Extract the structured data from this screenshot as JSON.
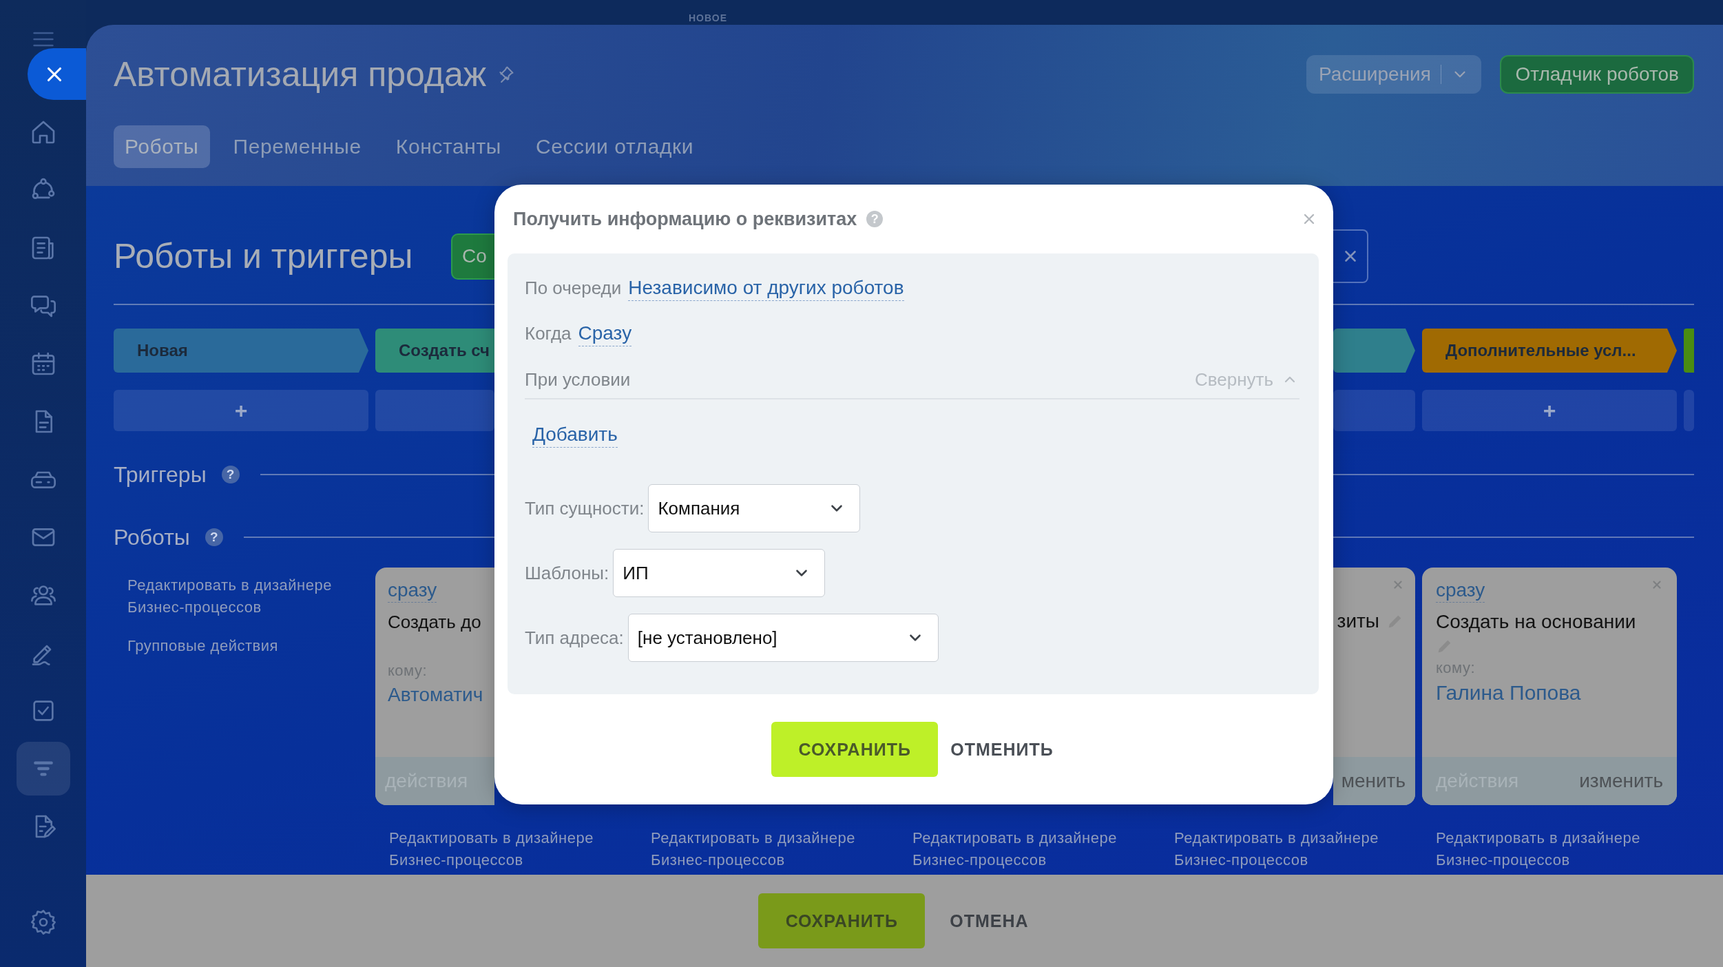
{
  "top_bar": {
    "badge": "НОВОЕ"
  },
  "sidebar": {
    "items": [
      {
        "kind": "menu",
        "selected": false
      },
      {
        "kind": "close",
        "selected": false
      },
      {
        "kind": "home",
        "selected": false
      },
      {
        "kind": "nodes",
        "selected": false
      },
      {
        "kind": "news",
        "selected": false
      },
      {
        "kind": "chat",
        "selected": false
      },
      {
        "kind": "calendar",
        "selected": false
      },
      {
        "kind": "document",
        "selected": false
      },
      {
        "kind": "drive",
        "selected": false
      },
      {
        "kind": "mail",
        "selected": false
      },
      {
        "kind": "people",
        "selected": false
      },
      {
        "kind": "pen",
        "selected": false
      },
      {
        "kind": "task",
        "selected": false
      },
      {
        "kind": "funnel",
        "selected": true
      },
      {
        "kind": "docedit",
        "selected": false
      },
      {
        "kind": "settings",
        "selected": false
      }
    ]
  },
  "header": {
    "title": "Автоматизация продаж",
    "extensions_button": "Расширения",
    "debugger_button": "Отладчик роботов",
    "tabs": [
      {
        "label": "Роботы",
        "selected": true
      },
      {
        "label": "Переменные",
        "selected": false
      },
      {
        "label": "Константы",
        "selected": false
      },
      {
        "label": "Сессии отладки",
        "selected": false
      }
    ]
  },
  "board": {
    "title": "Роботы и триггеры",
    "create_button": "Со",
    "stages": [
      {
        "kind": "full",
        "label": "Новая",
        "color": "#2a6a9a",
        "add": "+"
      },
      {
        "kind": "cut-right",
        "label": "Создать сч",
        "color": "#2e8c78"
      },
      {
        "kind": "cut-left",
        "color": "#2f7f8c"
      },
      {
        "kind": "full",
        "label": "Дополнительные усл...",
        "color": "#a06a02",
        "add": "+"
      },
      {
        "kind": "sliver",
        "color": "#4a8c12"
      }
    ],
    "triggers": {
      "title": "Триггеры",
      "help": "?"
    },
    "robots": {
      "title": "Роботы",
      "help": "?"
    },
    "side_links": [
      "Редактировать в дизайнере Бизнес-процессов",
      "Групповые действия"
    ],
    "cards": [
      {
        "kind": "cut-right",
        "trigger": "сразу",
        "title": "Создать до",
        "to_label": "кому:",
        "assignee": "Автоматич",
        "actions": "действия"
      },
      {
        "kind": "cut-left",
        "title": "зиты",
        "edit": "менить"
      },
      {
        "kind": "full",
        "trigger": "сразу",
        "title": "Создать на основании",
        "to_label": "кому:",
        "assignee": "Галина Попова",
        "actions": "действия",
        "edit": "изменить"
      }
    ],
    "designer_links": [
      "Редактировать в дизайнере Бизнес-процессов",
      "Редактировать в дизайнере Бизнес-процессов",
      "Редактировать в дизайнере Бизнес-процессов",
      "Редактировать в дизайнере Бизнес-процессов",
      "Редактировать в дизайнере Бизнес-процессов"
    ]
  },
  "footer": {
    "save": "СОХРАНИТЬ",
    "cancel": "ОТМЕНА"
  },
  "dialog": {
    "title": "Получить информацию о реквизитах",
    "help": "?",
    "rows": [
      {
        "label": "По очереди",
        "value": "Независимо от других роботов"
      },
      {
        "label": "Когда",
        "value": "Сразу"
      }
    ],
    "condition": {
      "label": "При условии",
      "toggle": "Свернуть",
      "expanded": true
    },
    "add_link": "Добавить",
    "fields": [
      {
        "label": "Тип сущности:",
        "value": "Компания"
      },
      {
        "label": "Шаблоны:",
        "value": "ИП"
      },
      {
        "label": "Тип адреса:",
        "value": "[не установлено]"
      }
    ],
    "save": "СОХРАНИТЬ",
    "cancel": "ОТМЕНИТЬ"
  }
}
